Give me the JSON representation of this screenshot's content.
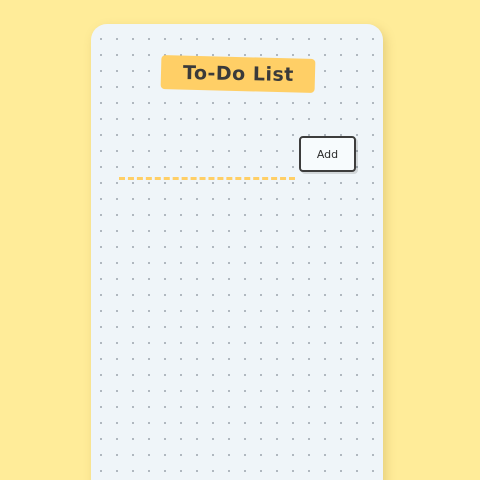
{
  "app": {
    "title": "To-Do List"
  },
  "new_task": {
    "value": "",
    "placeholder": "",
    "add_label": "Add"
  },
  "tasks": [],
  "colors": {
    "background": "#ffec99",
    "card": "#eff5f9",
    "accent": "#ffcf66",
    "text": "#3a3a3a",
    "button_border": "#3d3d3d"
  }
}
